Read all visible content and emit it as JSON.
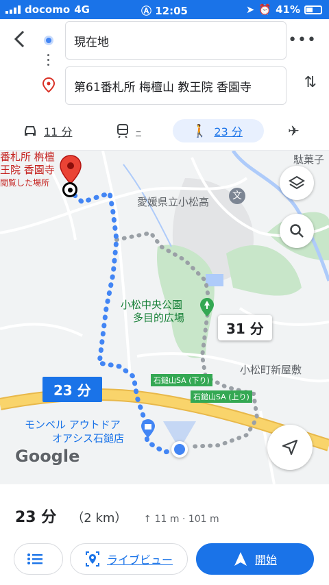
{
  "status_bar": {
    "carrier": "docomo",
    "network": "4G",
    "time": "12:05",
    "battery": "41%"
  },
  "header": {
    "origin": "現在地",
    "destination": "第61番札所 梅檀山 教王院 香園寺"
  },
  "modes": [
    {
      "name": "car",
      "label": "11 分",
      "selected": false
    },
    {
      "name": "transit",
      "label": "–",
      "selected": false
    },
    {
      "name": "walk",
      "label": "23 分",
      "selected": true
    },
    {
      "name": "flight",
      "label": "",
      "selected": false
    }
  ],
  "map": {
    "dest_label": [
      "番札所 栴檀",
      "王院 香園寺"
    ],
    "dest_sub": "閲覧した場所",
    "labels": {
      "school": "愛媛県立小松高",
      "park1": "小松中央公園",
      "park2": "多目的広場",
      "area": "小松町新屋敷",
      "sa_down": "石鎚山SA (下り)",
      "sa_up": "石鎚山SA (上り)",
      "shop1": "モンベル アウトドア",
      "shop2": "オアシス石鎚店",
      "top_right": "駄菓子"
    },
    "route_time": "23 分",
    "alt_route_time": "31 分",
    "logo": "Google"
  },
  "summary": {
    "time": "23 分",
    "distance": "（2 km）",
    "elevation": "11 m · 101 m"
  },
  "actions": {
    "steps_label": "",
    "live_view": "ライブビュー",
    "start": "開始"
  },
  "colors": {
    "primary": "#1a73e8",
    "route": "#4285f4",
    "alt_route": "#9aa0a6",
    "park": "#c8e6c9",
    "highway": "#f9d46b"
  }
}
